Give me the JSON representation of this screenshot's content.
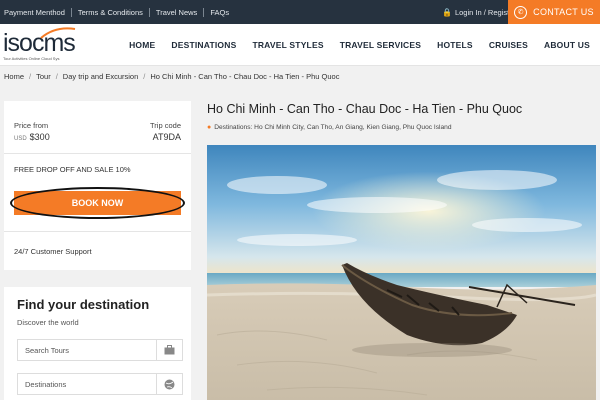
{
  "topbar": {
    "links": [
      "Payment Menthod",
      "Terms & Conditions",
      "Travel News",
      "FAQs"
    ],
    "login": "Login In / Register",
    "contact": "CONTACT US"
  },
  "logo": {
    "text": "isocms",
    "tagline": "Tour Activities Online Cloud Sys"
  },
  "nav": [
    "HOME",
    "DESTINATIONS",
    "TRAVEL STYLES",
    "TRAVEL SERVICES",
    "HOTELS",
    "CRUISES",
    "ABOUT US"
  ],
  "breadcrumb": [
    "Home",
    "Tour",
    "Day trip and Excursion",
    "Ho Chi Minh - Can Tho - Chau Doc - Ha Tien - Phu Quoc"
  ],
  "booking": {
    "price_label": "Price from",
    "currency": "USD",
    "price": "$300",
    "code_label": "Trip code",
    "code": "AT9DA",
    "promo": "FREE DROP OFF AND SALE 10%",
    "book_button": "BOOK NOW",
    "support": "24/7 Customer Support"
  },
  "finder": {
    "title": "Find your destination",
    "subtitle": "Discover the world",
    "search_placeholder": "Search Tours",
    "destinations_label": "Destinations"
  },
  "tour": {
    "title": "Ho Chi Minh - Can Tho - Chau Doc - Ha Tien - Phu Quoc",
    "destinations": "Destinations: Ho Chi Minh City, Can Tho, An Giang, Kien Giang, Phu Quoc Island"
  },
  "colors": {
    "accent": "#f47b26",
    "topbar": "#26323f"
  },
  "icons": {
    "login": "lock-icon",
    "contact": "phone-icon",
    "search": "briefcase-icon",
    "destinations": "globe-icon",
    "location": "map-pin-icon"
  }
}
